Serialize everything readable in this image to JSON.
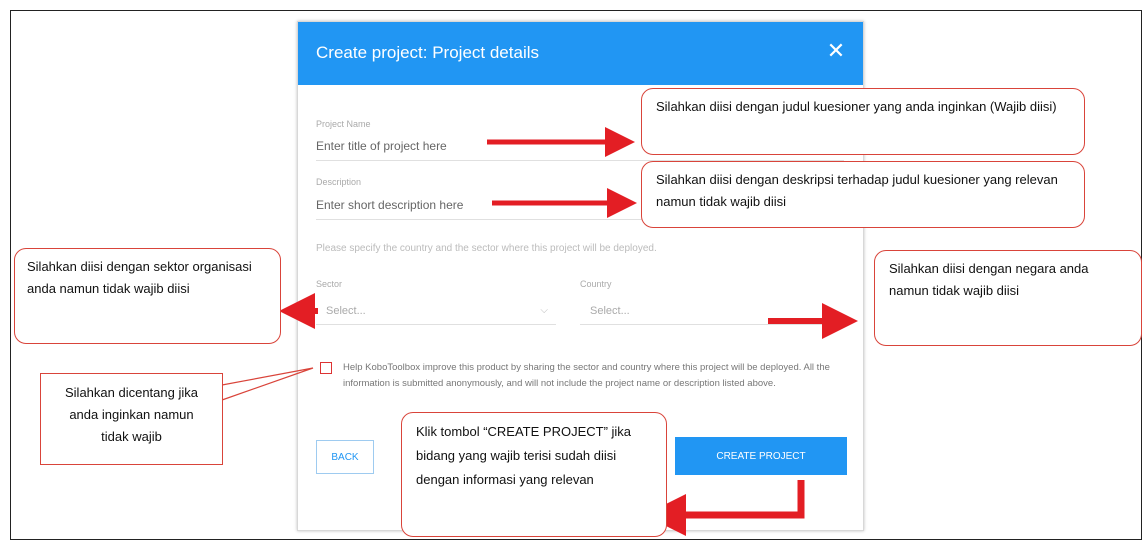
{
  "modal": {
    "title": "Create project: Project details",
    "close_glyph": "✕",
    "project_name": {
      "label": "Project Name",
      "placeholder": "Enter title of project here"
    },
    "description": {
      "label": "Description",
      "placeholder": "Enter short description here"
    },
    "hint": "Please specify the country and the sector where this project will be deployed.",
    "sector": {
      "label": "Sector",
      "value": "Select..."
    },
    "country": {
      "label": "Country",
      "value": "Select..."
    },
    "consent_text": "Help KoboToolbox improve this product by sharing the sector and country where this project will be deployed. All the information is submitted anonymously, and will not include the project name or description listed above.",
    "back_label": "BACK",
    "create_label": "CREATE PROJECT",
    "accent_color": "#2196f3"
  },
  "callouts": {
    "name": "Silahkan diisi dengan judul kuesioner yang anda inginkan (Wajib diisi)",
    "description": "Silahkan diisi dengan deskripsi terhadap judul kuesioner yang relevan namun tidak wajib diisi",
    "sector": "Silahkan diisi dengan sektor organisasi anda namun tidak wajib diisi",
    "country": "Silahkan diisi dengan negara anda namun tidak wajib diisi",
    "checkbox": "Silahkan dicentang jika anda inginkan namun tidak wajib",
    "create": "Klik tombol “CREATE PROJECT” jika bidang yang wajib terisi sudah diisi dengan informasi yang relevan"
  },
  "annotation_color": "#e31e24"
}
